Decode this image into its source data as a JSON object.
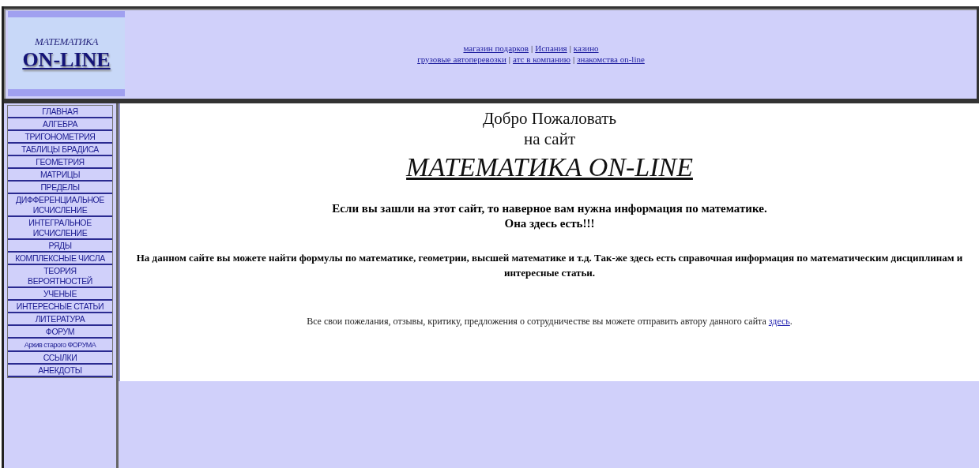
{
  "logo": {
    "top": "МАТЕМАТИКА",
    "bottom": "ON-LINE"
  },
  "header_links": [
    [
      {
        "kind": "link",
        "text": "магазин подарков"
      },
      {
        "kind": "separator",
        "text": "|"
      },
      {
        "kind": "link",
        "text": "Испания"
      },
      {
        "kind": "separator",
        "text": "|"
      },
      {
        "kind": "link",
        "text": "казино"
      }
    ],
    [
      {
        "kind": "link",
        "text": "грузовые автоперевозки"
      },
      {
        "kind": "separator",
        "text": "|"
      },
      {
        "kind": "link",
        "text": "атс в компанию"
      },
      {
        "kind": "separator",
        "text": "|"
      },
      {
        "kind": "link",
        "text": "знакомства on-line"
      }
    ]
  ],
  "sidebar": {
    "items": [
      {
        "kind": "normal",
        "label": "ГЛАВНАЯ"
      },
      {
        "kind": "normal",
        "label": "АЛГЕБРА"
      },
      {
        "kind": "normal",
        "label": "ТРИГОНОМЕТРИЯ"
      },
      {
        "kind": "normal",
        "label": "ТАБЛИЦЫ БРАДИСА"
      },
      {
        "kind": "normal",
        "label": "ГЕОМЕТРИЯ"
      },
      {
        "kind": "normal",
        "label": "МАТРИЦЫ"
      },
      {
        "kind": "normal",
        "label": "ПРЕДЕЛЫ"
      },
      {
        "kind": "normal",
        "label": "ДИФФЕРЕНЦИАЛЬНОЕ\nИСЧИСЛЕНИЕ"
      },
      {
        "kind": "normal",
        "label": "ИНТЕГРАЛЬНОЕ\nИСЧИСЛЕНИЕ"
      },
      {
        "kind": "normal",
        "label": "РЯДЫ"
      },
      {
        "kind": "normal",
        "label": "КОМПЛЕКСНЫЕ ЧИСЛА"
      },
      {
        "kind": "normal",
        "label": "ТЕОРИЯ\nВЕРОЯТНОСТЕЙ"
      },
      {
        "kind": "normal",
        "label": "УЧЕНЫЕ"
      },
      {
        "kind": "normal",
        "label": "ИНТЕРЕСНЫЕ СТАТЬИ"
      },
      {
        "kind": "normal",
        "label": "ЛИТЕРАТУРА"
      },
      {
        "kind": "normal",
        "label": "ФОРУМ"
      },
      {
        "kind": "small",
        "label": "Архив старого ФОРУМА"
      },
      {
        "kind": "normal",
        "label": "ССЫЛКИ"
      },
      {
        "kind": "normal",
        "label": "АНЕКДОТЫ"
      }
    ]
  },
  "content": {
    "welcome": "Добро Пожаловать",
    "subtitle": "на сайт",
    "site_title": "МАТЕМАТИКА ON-LINE",
    "intro": "Если вы зашли на этот сайт, то наверное вам нужна информация по математике.\nОна здесь есть!!!",
    "description": "На данном сайте вы можете найти формулы по математике, геометрии, высшей математике и т.д. Так-же здесь есть справочная информация по математическим дисциплинам и интересные статьи.",
    "contact": {
      "text": "Все свои пожелания, отзывы, критику, предложения о сотрудничестве вы можете отправить автору данного сайта ",
      "link": "здесь",
      "after": "."
    }
  }
}
